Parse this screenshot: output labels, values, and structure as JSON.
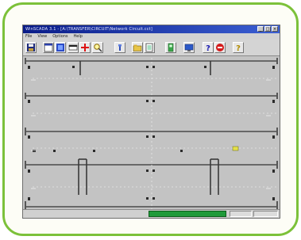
{
  "window": {
    "title": "WinSCADA 3.1 - [A:\\TRANSFER\\CIRCUIT\\Network Circuit.cct]"
  },
  "menu": {
    "items": [
      {
        "label": "File"
      },
      {
        "label": "View"
      },
      {
        "label": "Options"
      },
      {
        "label": "Help"
      }
    ]
  },
  "toolbar": {
    "buttons": [
      {
        "icon": "save-icon"
      },
      {
        "icon": "window-icon"
      },
      {
        "icon": "blue-panel-icon"
      },
      {
        "icon": "white-card-icon"
      },
      {
        "icon": "red-plus-icon"
      },
      {
        "icon": "zoom-icon"
      },
      {
        "icon": "probe-icon"
      },
      {
        "icon": "folder-icon"
      },
      {
        "icon": "document-icon"
      },
      {
        "icon": "green-gauge-icon"
      },
      {
        "icon": "blue-monitor-icon"
      },
      {
        "icon": "help-icon"
      },
      {
        "icon": "stop-icon"
      },
      {
        "icon": "help-icon"
      }
    ]
  },
  "status": {
    "progress_text": "",
    "panel_1": "",
    "panel_2": ""
  },
  "colors": {
    "frame_border": "#7cc13a",
    "title_bar": "#0a1c88",
    "canvas": "#c3c3c3",
    "status_progress": "#1f9a3a",
    "highlight_component": "#e4e04a"
  }
}
